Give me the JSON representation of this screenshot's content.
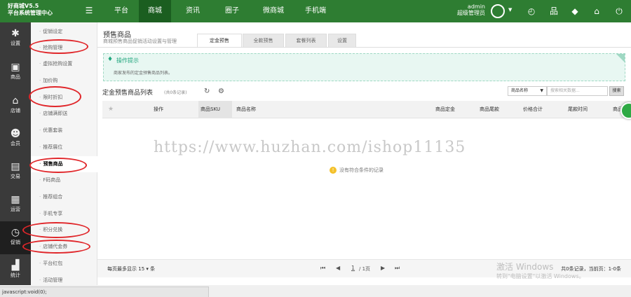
{
  "brand": {
    "line1": "好商城V5.5",
    "line2": "平台系统管理中心"
  },
  "top_nav": [
    {
      "label": "平台",
      "active": false
    },
    {
      "label": "商城",
      "active": true
    },
    {
      "label": "资讯",
      "active": false
    },
    {
      "label": "圈子",
      "active": false
    },
    {
      "label": "微商城",
      "active": false
    },
    {
      "label": "手机端",
      "active": false
    }
  ],
  "user": {
    "name": "admin",
    "role": "超级管理员"
  },
  "top_icons": [
    "clock-icon",
    "sitemap-icon",
    "brush-icon",
    "home-icon",
    "power-icon"
  ],
  "side_icons": [
    {
      "label": "设置",
      "glyph": "✱",
      "active": false
    },
    {
      "label": "商品",
      "glyph": "▣",
      "active": false
    },
    {
      "label": "店铺",
      "glyph": "⌂",
      "active": false
    },
    {
      "label": "会员",
      "glyph": "☻",
      "active": false
    },
    {
      "label": "交易",
      "glyph": "▤",
      "active": false
    },
    {
      "label": "运营",
      "glyph": "▦",
      "active": false
    },
    {
      "label": "促销",
      "glyph": "◷",
      "active": true
    },
    {
      "label": "统计",
      "glyph": "▟",
      "active": false
    }
  ],
  "sub_menu": [
    {
      "label": "促销设定",
      "active": false
    },
    {
      "label": "抢购管理",
      "active": false
    },
    {
      "label": "虚拟抢购设置",
      "active": false
    },
    {
      "label": "加价购",
      "active": false
    },
    {
      "label": "限时折扣",
      "active": false
    },
    {
      "label": "店铺满即送",
      "active": false
    },
    {
      "label": "优惠套装",
      "active": false
    },
    {
      "label": "推荐展位",
      "active": false
    },
    {
      "label": "预售商品",
      "active": true
    },
    {
      "label": "F码商品",
      "active": false
    },
    {
      "label": "推荐组合",
      "active": false
    },
    {
      "label": "手机专享",
      "active": false
    },
    {
      "label": "积分兑换",
      "active": false
    },
    {
      "label": "店铺代金券",
      "active": false
    },
    {
      "label": "平台红包",
      "active": false
    },
    {
      "label": "活动管理",
      "active": false
    }
  ],
  "page": {
    "title": "预售商品",
    "subtitle": "商城预售商品促销活动设置与管理"
  },
  "tabs": [
    {
      "label": "定金预售",
      "active": true
    },
    {
      "label": "全款预售",
      "active": false
    },
    {
      "label": "套餐列表",
      "active": false
    },
    {
      "label": "设置",
      "active": false
    }
  ],
  "tip": {
    "title": "操作提示",
    "text": "商家发布的定金预售商品列表。"
  },
  "list": {
    "title": "定金预售商品列表",
    "count": "(共0条记录)"
  },
  "search": {
    "field": "商品名称",
    "placeholder": "搜索相关数据...",
    "button": "搜索"
  },
  "columns": [
    "操作",
    "商品SKU",
    "商品名称",
    "商品定金",
    "商品尾款",
    "价格合计",
    "尾款时间",
    "商品"
  ],
  "watermark": "https://www.huzhan.com/ishop11135",
  "empty_message": "没有符合条件的记录",
  "pager": {
    "per_page_label": "每页最多显示",
    "per_page": "15",
    "per_page_unit": "条",
    "page_current": "1",
    "page_total": "/ 1页",
    "info": "共0条记录，当前页：1-0条"
  },
  "windows_watermark": {
    "line1": "激活 Windows",
    "line2": "转到\"电脑设置\"以激活 Windows。"
  },
  "status_bar": "javascript:void(0);",
  "colors": {
    "topbar": "#2e7d32",
    "sidebar": "#3a3a3a",
    "accent": "#20a67d",
    "annotation": "#e0262a"
  }
}
